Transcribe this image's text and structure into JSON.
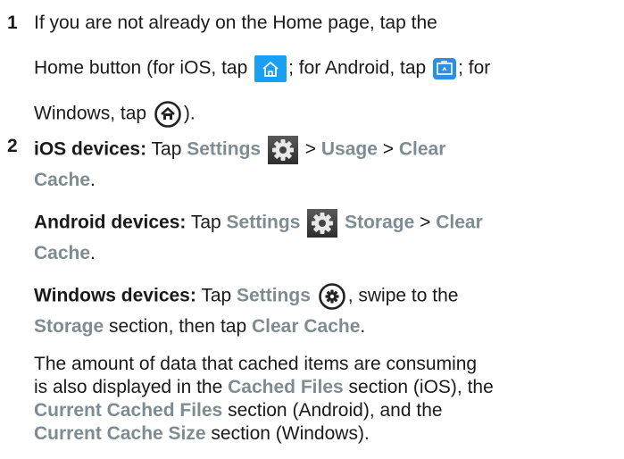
{
  "step1": {
    "number": "1",
    "line1": "If you are not already on the Home page, tap the",
    "line2_a": "Home button (for iOS, tap",
    "line2_b": "; for Android, tap",
    "line2_c": "; for",
    "line3_a": "Windows, tap",
    "line3_b": ")."
  },
  "step2": {
    "number": "2",
    "ios": {
      "label": "iOS devices:",
      "tap": "Tap",
      "settings": "Settings",
      "sep1": ">",
      "usage": "Usage",
      "sep2": ">",
      "clear": "Clear",
      "cache": "Cache",
      "end": "."
    },
    "android": {
      "label": "Android devices:",
      "tap": "Tap",
      "settings": "Settings",
      "storage": "Storage",
      "sep": ">",
      "clear": "Clear",
      "cache": "Cache",
      "end": "."
    },
    "windows": {
      "label": "Windows devices:",
      "tap": "Tap",
      "settings": "Settings",
      "after_icon": ", swipe to the",
      "storage": "Storage",
      "mid": "section, then tap",
      "clear_cache": "Clear Cache",
      "end": "."
    },
    "note": {
      "l1": "The amount of data that cached items are consuming",
      "l2_a": "is also displayed in the",
      "l2_cached": "Cached Files",
      "l2_b": "section (iOS), the",
      "l3_current": "Current Cached Files",
      "l3_b": "section (Android), and the",
      "l4_size": "Current Cache Size",
      "l4_b": "section (Windows)."
    }
  },
  "icons": {
    "home_ios": "home-icon",
    "home_android": "home-icon",
    "home_windows": "home-icon",
    "settings_gear": "gear-icon"
  },
  "colors": {
    "ui_term": "#7d8c93",
    "ios_icon_bg": "#1aa0f2",
    "android_icon_bg": "#2a8fe6"
  }
}
